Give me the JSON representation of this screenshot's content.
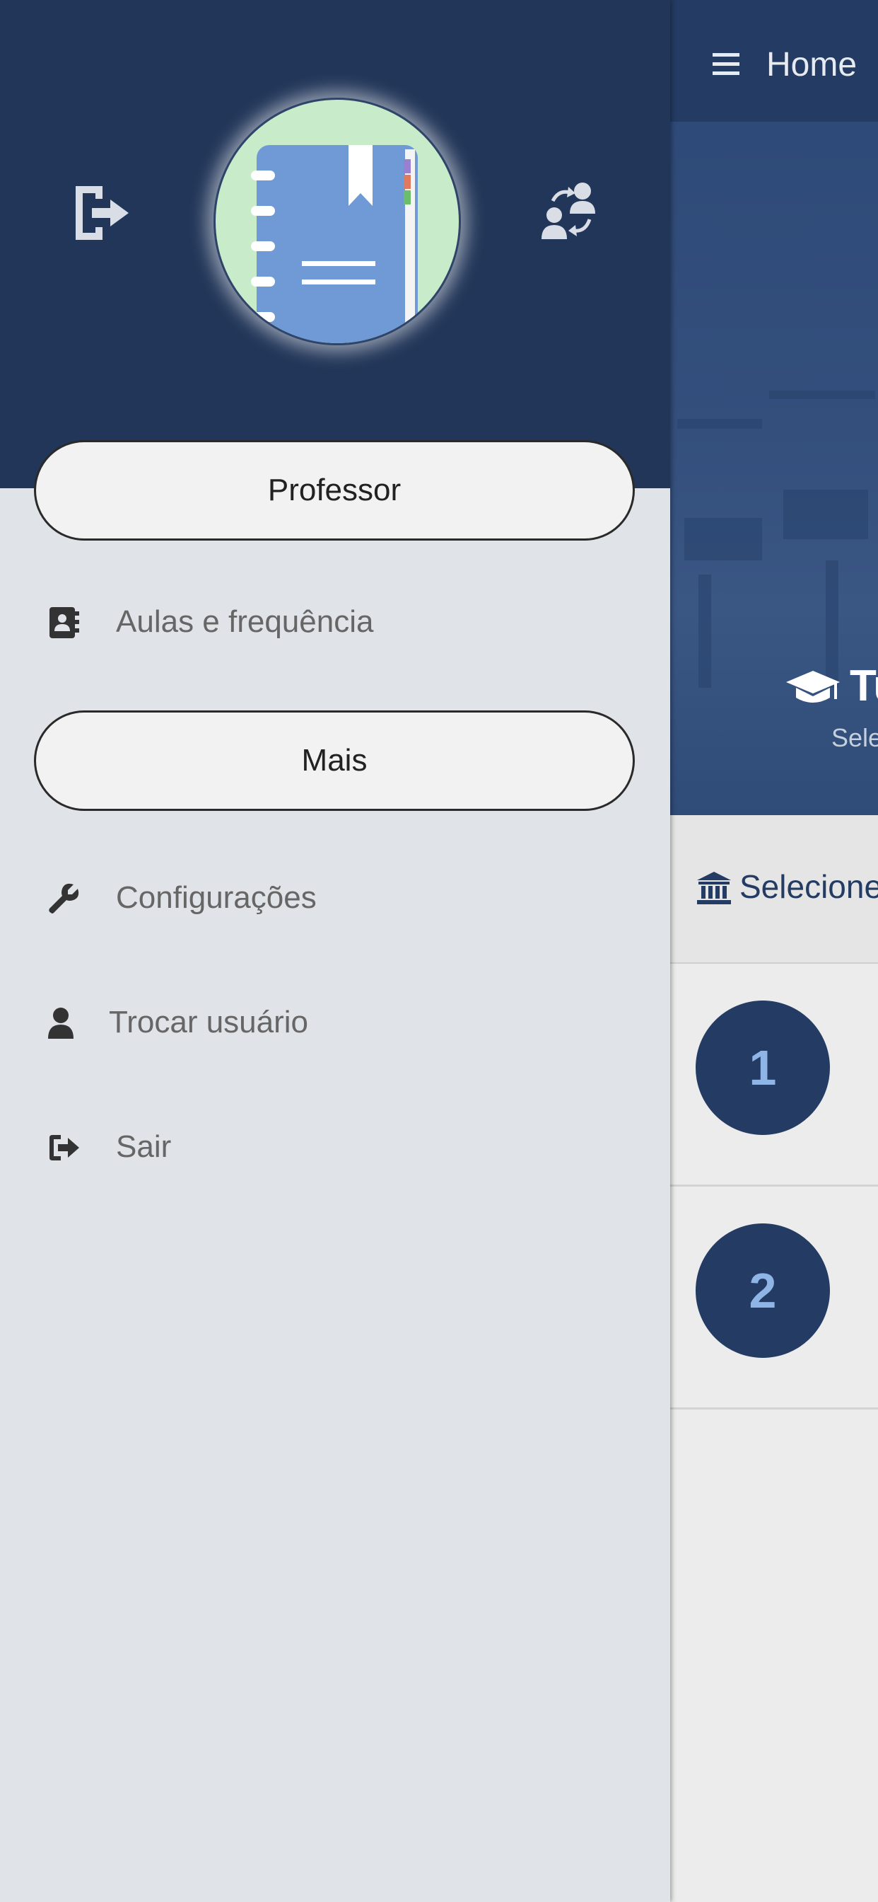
{
  "main": {
    "header_title": "Home",
    "hero_title": "Tu",
    "hero_subtitle": "Sele",
    "selector_label": "Selecione",
    "rows": [
      {
        "number": "1"
      },
      {
        "number": "2"
      }
    ]
  },
  "drawer": {
    "profile_button": "Professor",
    "items": [
      {
        "label": "Aulas e frequência",
        "icon": "contact-book-icon"
      },
      {
        "label": "Configurações",
        "icon": "wrench-icon"
      },
      {
        "label": "Trocar usuário",
        "icon": "user-icon"
      },
      {
        "label": "Sair",
        "icon": "sign-out-icon"
      }
    ],
    "more_button": "Mais"
  },
  "colors": {
    "header": "#223659",
    "drawer_bg": "#e0e3e7",
    "primary": "#243b63",
    "number_text": "#8fb4e6"
  }
}
